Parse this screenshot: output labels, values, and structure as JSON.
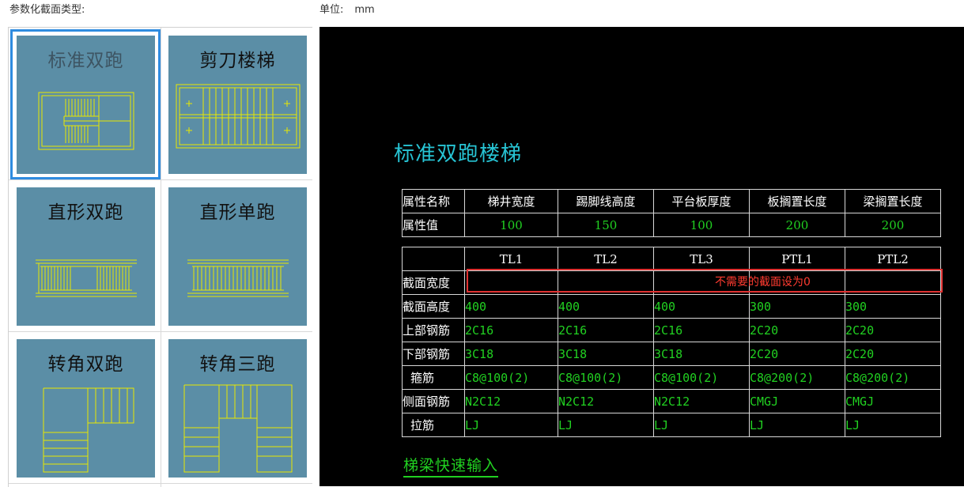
{
  "header": {
    "left_label": "参数化截面类型:",
    "unit_label": "单位:",
    "unit_value": "mm"
  },
  "gallery": {
    "items": [
      {
        "label": "标准双跑",
        "selected": true,
        "icon": "standard-double-stair-icon"
      },
      {
        "label": "剪刀楼梯",
        "selected": false,
        "icon": "scissor-stair-icon"
      },
      {
        "label": "直形双跑",
        "selected": false,
        "icon": "straight-double-stair-icon"
      },
      {
        "label": "直形单跑",
        "selected": false,
        "icon": "straight-single-stair-icon"
      },
      {
        "label": "转角双跑",
        "selected": false,
        "icon": "corner-double-stair-icon"
      },
      {
        "label": "转角三跑",
        "selected": false,
        "icon": "corner-triple-stair-icon"
      }
    ]
  },
  "preview": {
    "title": "标准双跑楼梯",
    "props": {
      "headers": [
        "属性名称",
        "梯井宽度",
        "踢脚线高度",
        "平台板厚度",
        "板搁置长度",
        "梁搁置长度"
      ],
      "values": [
        "属性值",
        "100",
        "150",
        "100",
        "200",
        "200"
      ]
    },
    "beams": {
      "columns": [
        "",
        "TL1",
        "TL2",
        "TL3",
        "PTL1",
        "PTL2"
      ],
      "section_width_label": "截面宽度",
      "rows": [
        {
          "label": "截面高度",
          "values": [
            "400",
            "400",
            "400",
            "300",
            "300"
          ]
        },
        {
          "label": "上部钢筋",
          "values": [
            "2C16",
            "2C16",
            "2C16",
            "2C20",
            "2C20"
          ]
        },
        {
          "label": "下部钢筋",
          "values": [
            "3C18",
            "3C18",
            "3C18",
            "2C20",
            "2C20"
          ]
        },
        {
          "label": "箍筋",
          "values": [
            "C8@100(2)",
            "C8@100(2)",
            "C8@100(2)",
            "C8@200(2)",
            "C8@200(2)"
          ]
        },
        {
          "label": "侧面钢筋",
          "values": [
            "N2C12",
            "N2C12",
            "N2C12",
            "CMGJ",
            "CMGJ"
          ]
        },
        {
          "label": "拉筋",
          "values": [
            "LJ",
            "LJ",
            "LJ",
            "LJ",
            "LJ"
          ]
        }
      ]
    },
    "note": "不需要的截面设为0",
    "quick_input": "梯梁快速输入"
  },
  "colors": {
    "tile_bg": "#5b8ea6",
    "selection": "#2f8ce0",
    "cad_bg": "#000000",
    "cad_title": "#27c4d4",
    "cad_value": "#21d021",
    "cad_stroke": "#e8e800",
    "note_red": "#ff3b30"
  }
}
